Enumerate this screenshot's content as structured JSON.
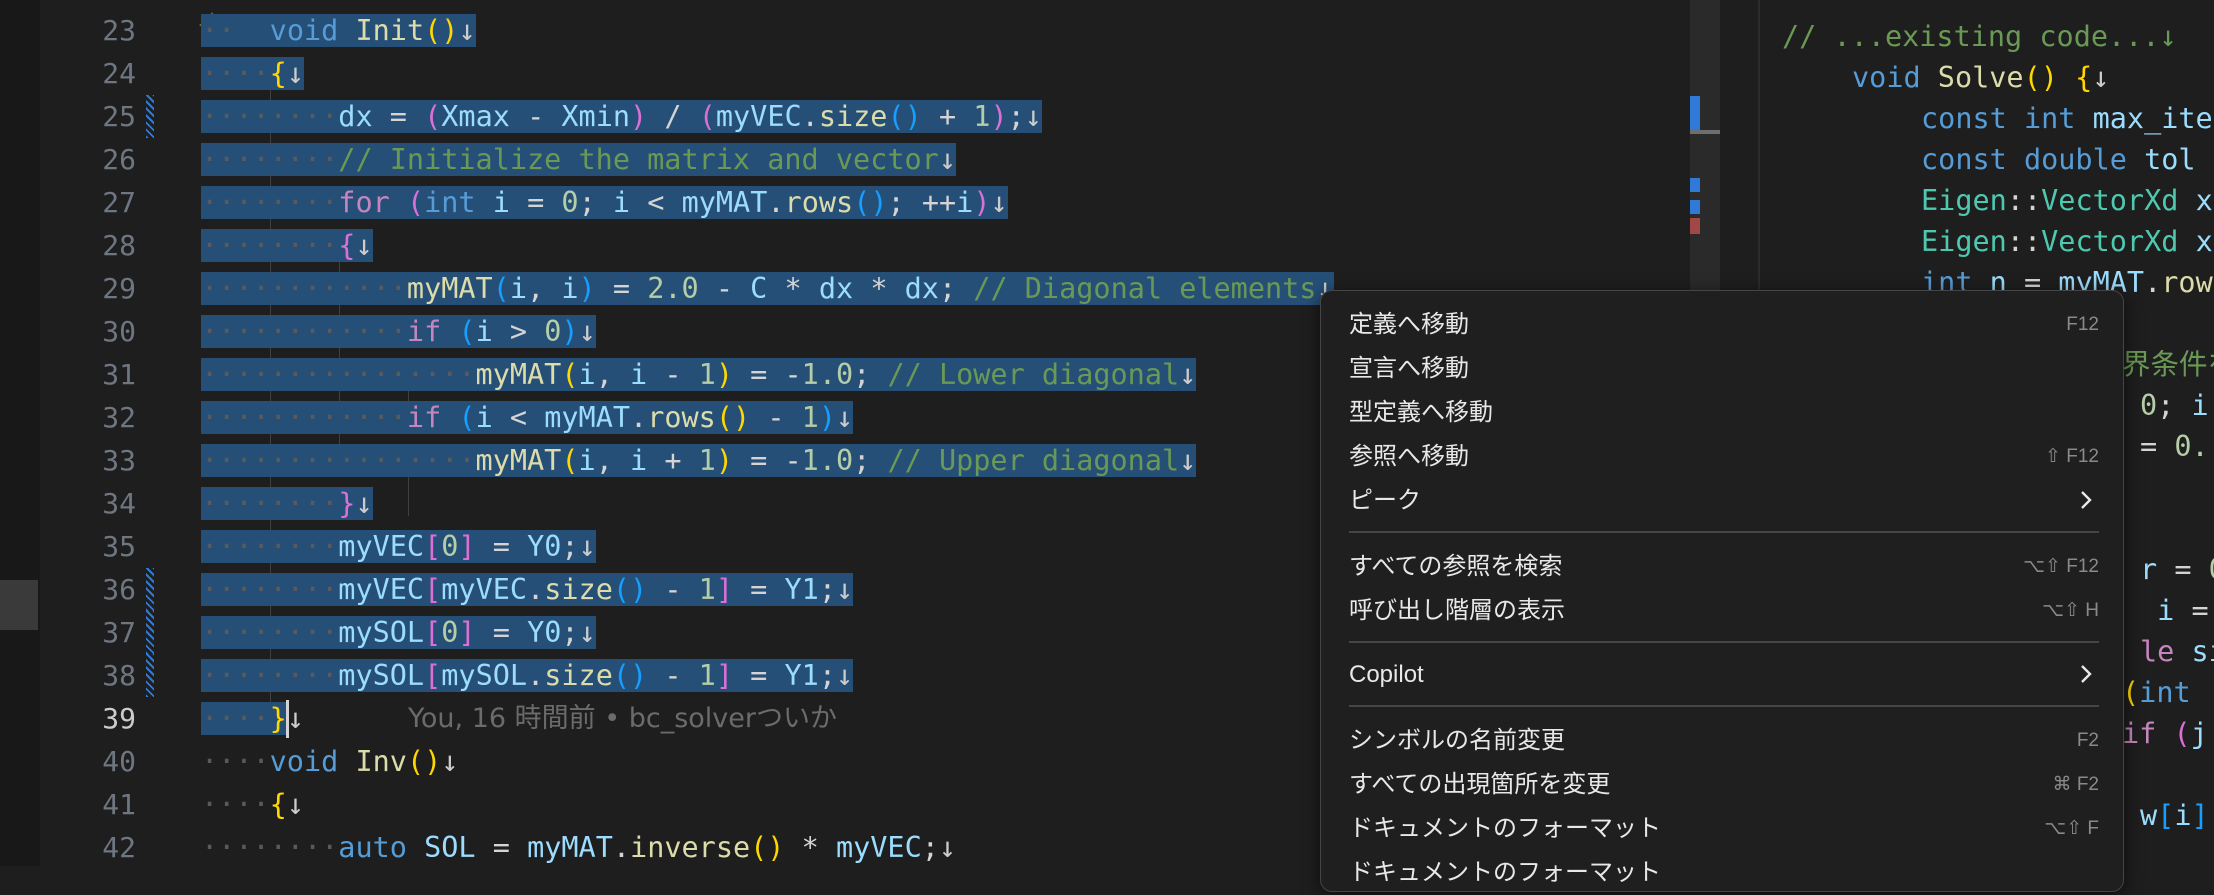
{
  "editor": {
    "lines": [
      {
        "n": "23",
        "text": "void Init()↓"
      },
      {
        "n": "24",
        "text": "{↓"
      },
      {
        "n": "25",
        "text": "dx = (Xmax - Xmin) / (myVEC.size() + 1);↓"
      },
      {
        "n": "26",
        "text": "// Initialize the matrix and vector↓"
      },
      {
        "n": "27",
        "text": "for (int i = 0; i < myMAT.rows(); ++i)↓"
      },
      {
        "n": "28",
        "text": "{↓"
      },
      {
        "n": "29",
        "text": "myMAT(i, i) = 2.0 - C * dx * dx; // Diagonal elements↓"
      },
      {
        "n": "30",
        "text": "if (i > 0)↓"
      },
      {
        "n": "31",
        "text": "myMAT(i, i - 1) = -1.0; // Lower diagonal↓"
      },
      {
        "n": "32",
        "text": "if (i < myMAT.rows() - 1)↓"
      },
      {
        "n": "33",
        "text": "myMAT(i, i + 1) = -1.0; // Upper diagonal↓"
      },
      {
        "n": "34",
        "text": "}↓"
      },
      {
        "n": "35",
        "text": "myVEC[0] = Y0;↓"
      },
      {
        "n": "36",
        "text": "myVEC[myVEC.size() - 1] = Y1;↓"
      },
      {
        "n": "37",
        "text": "mySOL[0] = Y0;↓"
      },
      {
        "n": "38",
        "text": "mySOL[mySOL.size() - 1] = Y1;↓"
      },
      {
        "n": "39",
        "text": "}↓"
      },
      {
        "n": "40",
        "text": "void Inv()↓"
      },
      {
        "n": "41",
        "text": "{↓"
      },
      {
        "n": "42",
        "text": "auto SOL = myMAT.inverse() * myVEC;↓"
      }
    ],
    "blame": "You, 16 時間前 • bc_solverついか"
  },
  "right_pane": {
    "lines": [
      "// ...existing code...↓",
      "void Solve() {↓",
      "const int max_ite",
      "const double tol",
      "Eigen::VectorXd x",
      "Eigen::VectorXd x",
      "int n = myMAT.row",
      "界条件を",
      "0; i",
      "= 0.",
      "",
      "",
      "r = 0",
      "i =",
      "le si",
      "(int",
      "if (j",
      "",
      "w[i]"
    ]
  },
  "context_menu": {
    "items": [
      {
        "label": "定義へ移動",
        "key": "F12"
      },
      {
        "label": "宣言へ移動",
        "key": ""
      },
      {
        "label": "型定義へ移動",
        "key": ""
      },
      {
        "label": "参照へ移動",
        "key": "⇧ F12"
      },
      {
        "label": "ピーク",
        "key": "",
        "submenu": true
      },
      {
        "label": "すべての参照を検索",
        "key": "⌥⇧ F12"
      },
      {
        "label": "呼び出し階層の表示",
        "key": "⌥⇧ H"
      },
      {
        "label": "Copilot",
        "key": "",
        "submenu": true
      },
      {
        "label": "シンボルの名前変更",
        "key": "F2"
      },
      {
        "label": "すべての出現箇所を変更",
        "key": "⌘ F2"
      },
      {
        "label": "ドキュメントのフォーマット",
        "key": "⌥⇧ F"
      },
      {
        "label": "ドキュメントのフォーマット",
        "key": ""
      }
    ]
  },
  "colors": {
    "selection": "#264f78",
    "keyword": "#569cd6",
    "comment": "#6a9955",
    "function": "#dcdcaa",
    "variable": "#9cdcfe"
  }
}
